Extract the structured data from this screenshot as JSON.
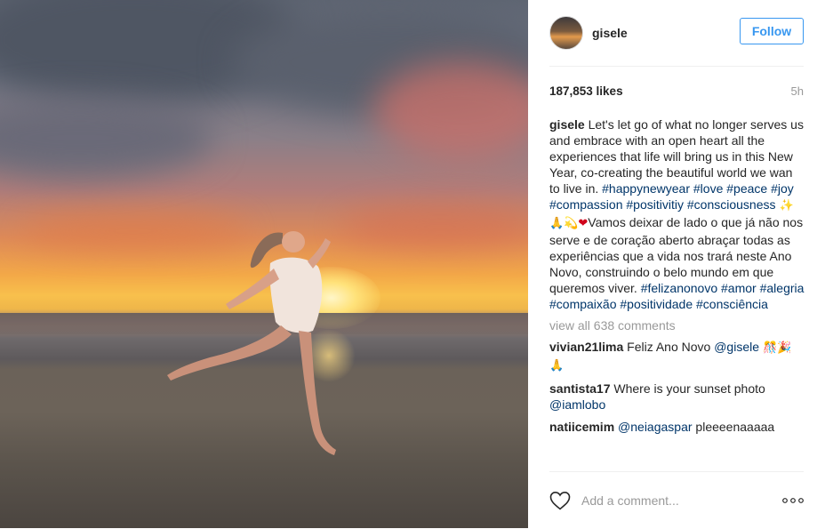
{
  "post": {
    "username": "gisele",
    "follow_label": "Follow",
    "likes": "187,853 likes",
    "time_ago": "5h",
    "caption": {
      "username": "gisele",
      "text_1": " Let's let go of what no longer serves us and embrace with an open heart all the experiences that life will bring us in this New Year, co-creating the beautiful world we wan to live in. ",
      "tags_1": [
        "#happynewyear",
        "#love",
        "#peace",
        "#joy",
        "#compassion",
        "#positivitiy",
        "#consciousness"
      ],
      "emoji_1": " ✨🙏💫",
      "heart_emoji": "❤",
      "text_2": "Vamos deixar de lado o que já não nos serve e de coração aberto abraçar todas as experiências que a vida nos trará neste Ano Novo, construindo o belo mundo em que queremos viver. ",
      "tags_2": [
        "#felizanonovo",
        "#amor",
        "#alegria",
        "#compaixão",
        "#positividade",
        "#consciência"
      ]
    },
    "view_all_comments": "view all 638 comments",
    "comments": [
      {
        "username": "vivian21lima",
        "text": " Feliz Ano Novo ",
        "mention": "@gisele",
        "emoji": " 🎊🎉🙏"
      },
      {
        "username": "santista17",
        "text": " Where is your sunset photo ",
        "mention": "@iamlobo",
        "emoji": ""
      },
      {
        "username": "natiicemim",
        "text": " pleeeenaaaaa",
        "mention": "@neiagaspar",
        "emoji": ""
      }
    ],
    "add_comment_placeholder": "Add a comment...",
    "icons": {
      "like": "heart-icon",
      "more": "more-options-icon"
    }
  },
  "colors": {
    "accent": "#3897f0",
    "hashtag": "#003569",
    "muted": "#999999",
    "text": "#262626"
  }
}
